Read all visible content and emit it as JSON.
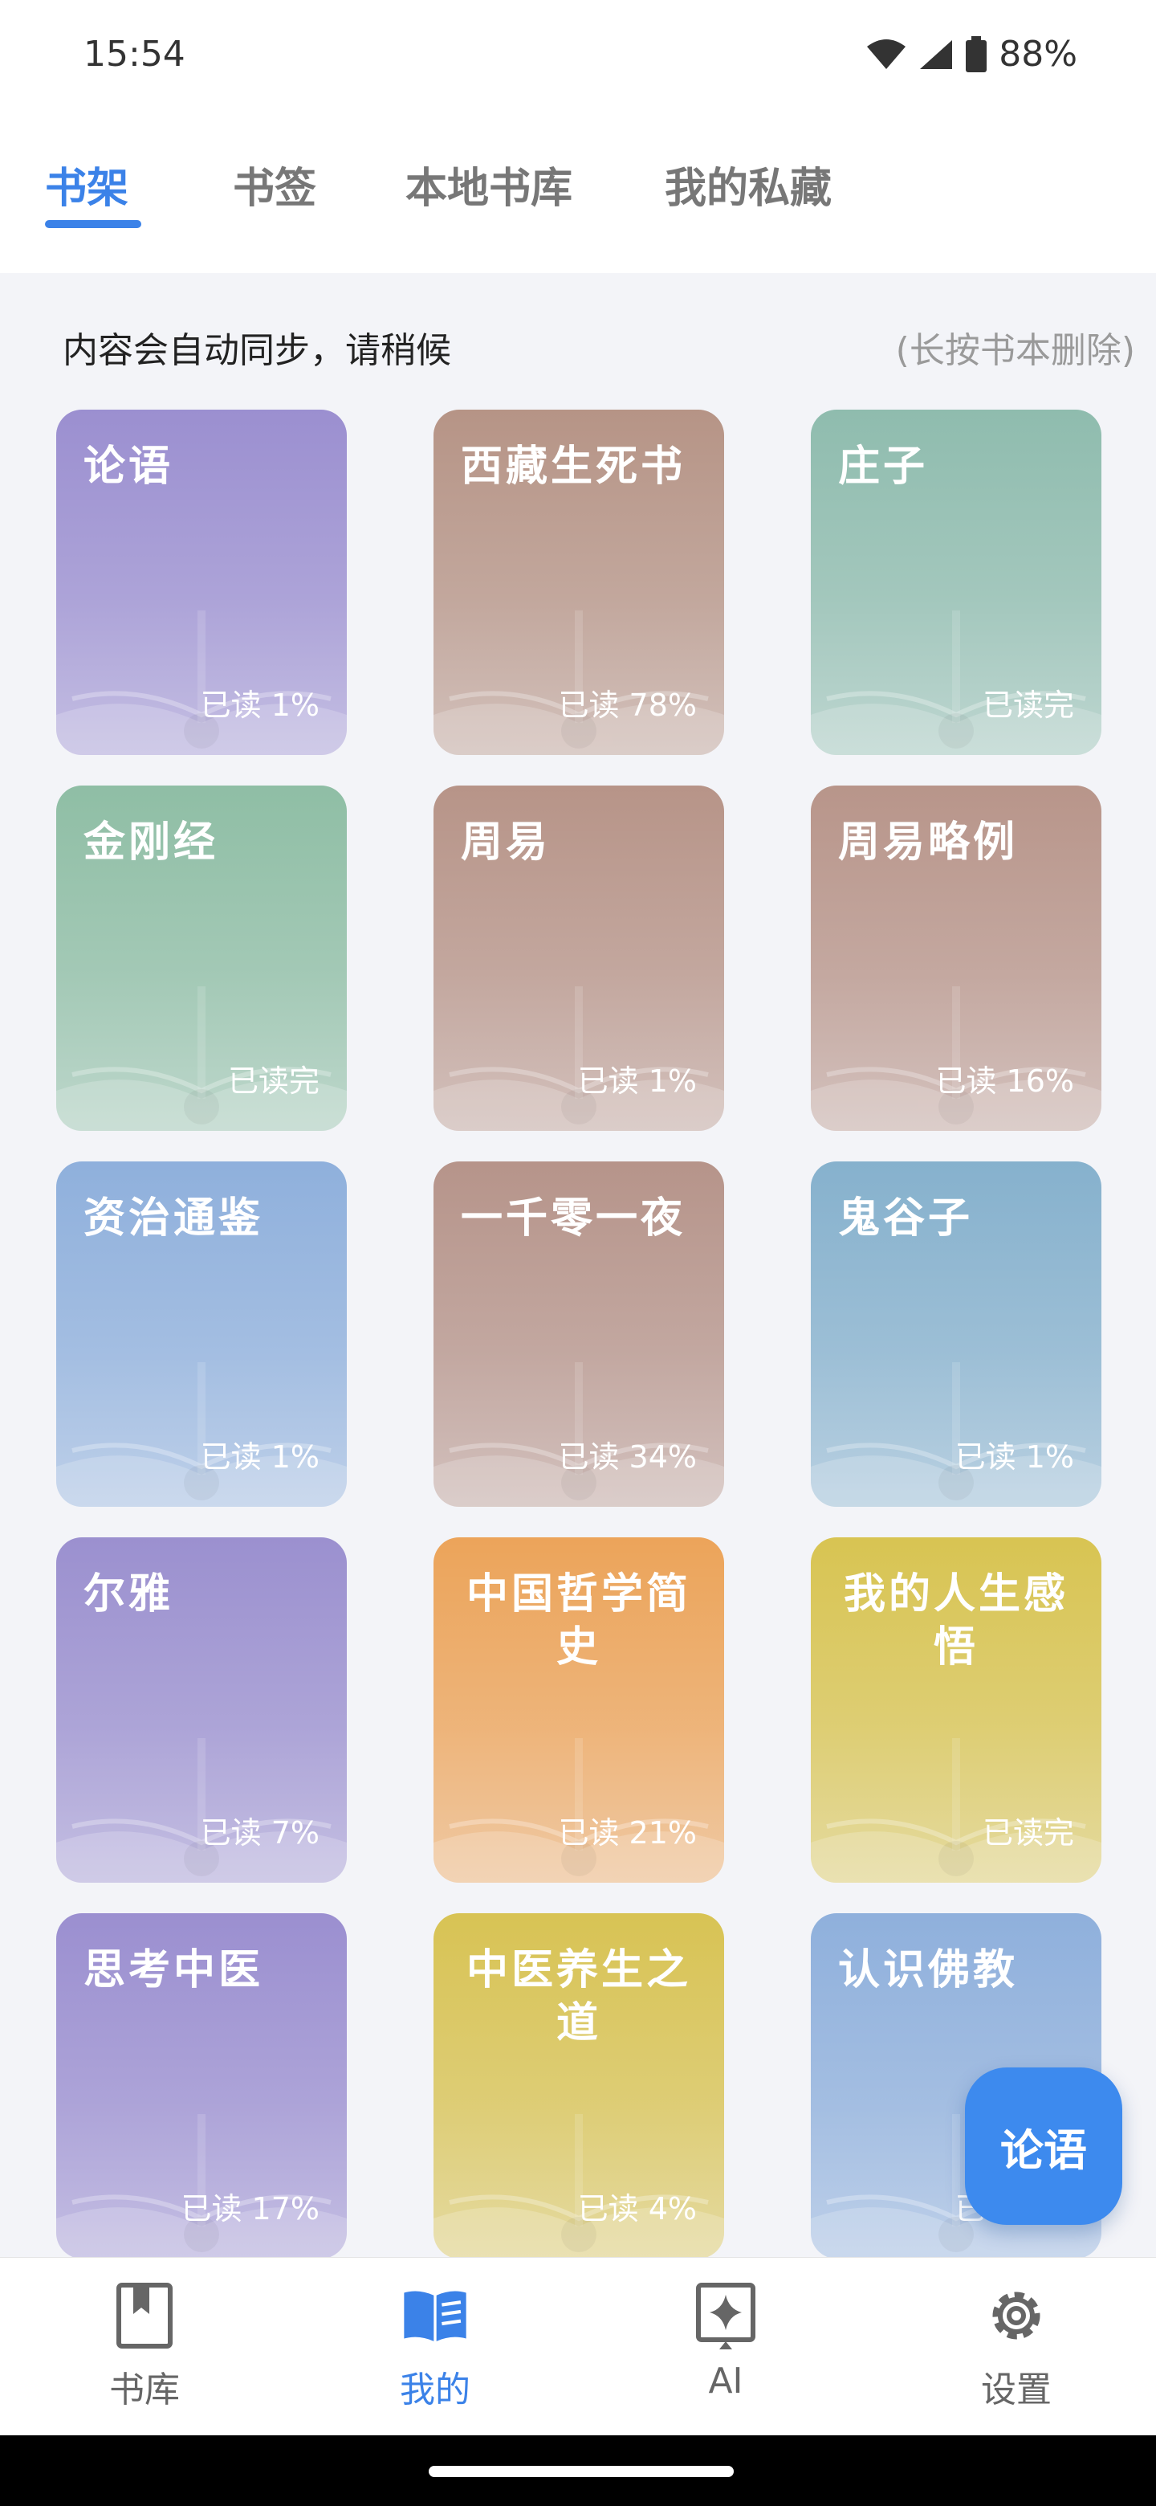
{
  "status": {
    "time": "15:54",
    "battery": "88%",
    "icons": [
      "wifi-icon",
      "signal-icon",
      "battery-icon"
    ]
  },
  "tabs": [
    {
      "label": "书架",
      "active": true
    },
    {
      "label": "书签",
      "active": false
    },
    {
      "label": "本地书库",
      "active": false
    },
    {
      "label": "我的私藏",
      "active": false
    }
  ],
  "shelf": {
    "notice": "内容会自动同步，请稍候",
    "hint": "(长按书本删除)",
    "books": [
      {
        "title": "论语",
        "progress": "已读 1%",
        "color": "#9b8fd0"
      },
      {
        "title": "西藏生死书",
        "progress": "已读 78%",
        "color": "#b69486"
      },
      {
        "title": "庄子",
        "progress": "已读完",
        "color": "#8fbcae"
      },
      {
        "title": "金刚经",
        "progress": "已读完",
        "color": "#8fbea5"
      },
      {
        "title": "周易",
        "progress": "已读 1%",
        "color": "#b79488"
      },
      {
        "title": "周易略例",
        "progress": "已读 16%",
        "color": "#b8958a"
      },
      {
        "title": "资治通鉴",
        "progress": "已读 1%",
        "color": "#8fb0dc"
      },
      {
        "title": "一千零一夜",
        "progress": "已读 34%",
        "color": "#b6948a"
      },
      {
        "title": "鬼谷子",
        "progress": "已读 1%",
        "color": "#86b1cd"
      },
      {
        "title": "尔雅",
        "progress": "已读 7%",
        "color": "#9b90cf"
      },
      {
        "title": "中国哲学简史",
        "progress": "已读 21%",
        "color": "#eca45a"
      },
      {
        "title": "我的人生感悟",
        "progress": "已读完",
        "color": "#d8c452"
      },
      {
        "title": "思考中医",
        "progress": "已读 17%",
        "color": "#9b8fd0"
      },
      {
        "title": "中医养生之道",
        "progress": "已读 4%",
        "color": "#d8c354"
      },
      {
        "title": "认识佛教",
        "progress": "已读 1%",
        "color": "#8fb0dc"
      }
    ]
  },
  "fab": {
    "label": "论语"
  },
  "bottom_nav": [
    {
      "label": "书库",
      "icon": "bookmark-book-icon",
      "active": false
    },
    {
      "label": "我的",
      "icon": "open-book-icon",
      "active": true
    },
    {
      "label": "AI",
      "icon": "ai-sparkle-icon",
      "active": false
    },
    {
      "label": "设置",
      "icon": "gear-icon",
      "active": false
    }
  ]
}
